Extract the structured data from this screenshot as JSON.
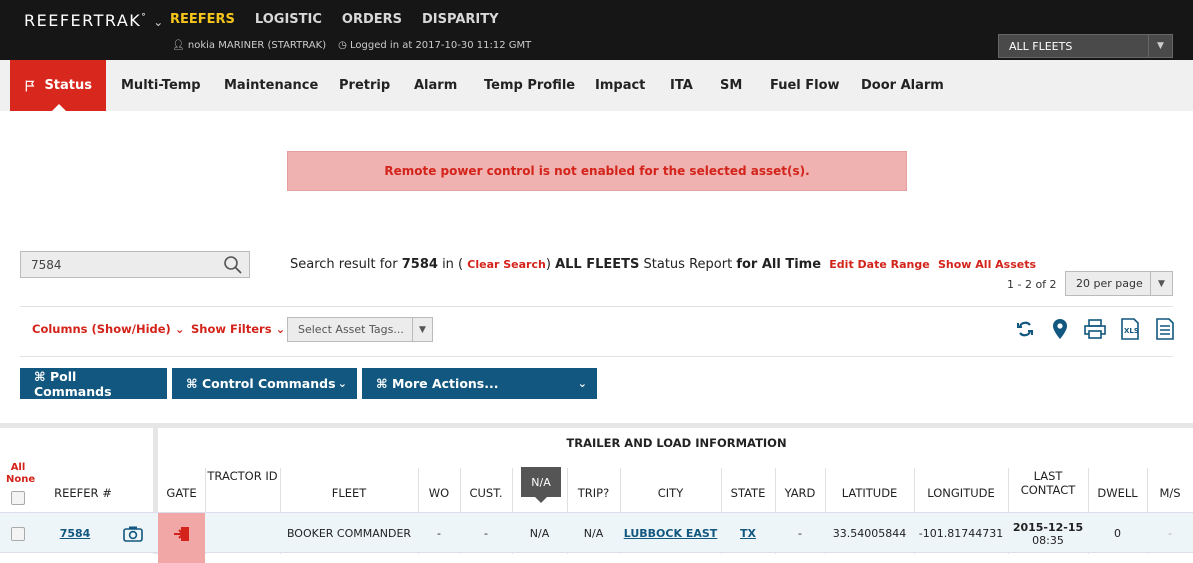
{
  "header": {
    "brand": "REEFERTRAK",
    "brand_mark": "°",
    "nav": [
      "REEFERS",
      "LOGISTIC",
      "ORDERS",
      "DISPARITY"
    ],
    "active_nav": "REEFERS",
    "user": "nokia MARINER (STARTRAK)",
    "logged_in": "Logged in at 2017-10-30 11:12 GMT",
    "fleet_selector": "ALL FLEETS"
  },
  "tabs": [
    "Status",
    "Multi-Temp",
    "Maintenance",
    "Pretrip",
    "Alarm",
    "Temp Profile",
    "Impact",
    "ITA",
    "SM",
    "Fuel Flow",
    "Door Alarm"
  ],
  "alert": "Remote power control is not enabled for the selected asset(s).",
  "search": {
    "value": "7584",
    "result_prefix": "Search result for",
    "term": "7584",
    "in_text": "in (",
    "clear_search": "Clear Search",
    "close_paren": ")",
    "fleet": "ALL FLEETS",
    "report": "Status Report",
    "period": "for All Time",
    "edit_range": "Edit Date Range",
    "show_all": "Show All Assets",
    "count": "1 - 2 of 2",
    "per_page": "20 per page"
  },
  "filters": {
    "columns": "Columns (Show/Hide)",
    "show_filters": "Show Filters",
    "tags_placeholder": "Select Asset Tags..."
  },
  "toolbar_icons": [
    "refresh-icon",
    "map-pin-icon",
    "print-icon",
    "xls-icon",
    "export-icon"
  ],
  "commands": {
    "poll": "⌘ Poll Commands",
    "control": "⌘ Control Commands",
    "more": "⌘ More Actions..."
  },
  "table": {
    "all_label": "All",
    "none_label": "None",
    "group_header": "TRAILER AND LOAD INFORMATION",
    "tooltip": "N/A",
    "columns": {
      "reefer": "REEFER #",
      "gate": "GATE",
      "tractor": "TRACTOR ID",
      "fleet": "FLEET",
      "wo": "WO",
      "cust": "CUST.",
      "trip": "TRIP?",
      "city": "CITY",
      "state": "STATE",
      "yard": "YARD",
      "lat": "LATITUDE",
      "lon": "LONGITUDE",
      "last_contact": "LAST CONTACT",
      "dwell": "DWELL",
      "ms": "M/S"
    },
    "rows": [
      {
        "reefer": "7584",
        "tractor": "",
        "fleet": "BOOKER COMMANDER",
        "wo": "-",
        "cust": "-",
        "na": "N/A",
        "trip": "N/A",
        "city": "LUBBOCK EAST",
        "state": "TX",
        "yard": "-",
        "lat": "33.54005844",
        "lon": "-101.81744731",
        "last_date": "2015-12-15",
        "last_time": "08:35",
        "dwell": "0",
        "ms": "-"
      }
    ]
  }
}
